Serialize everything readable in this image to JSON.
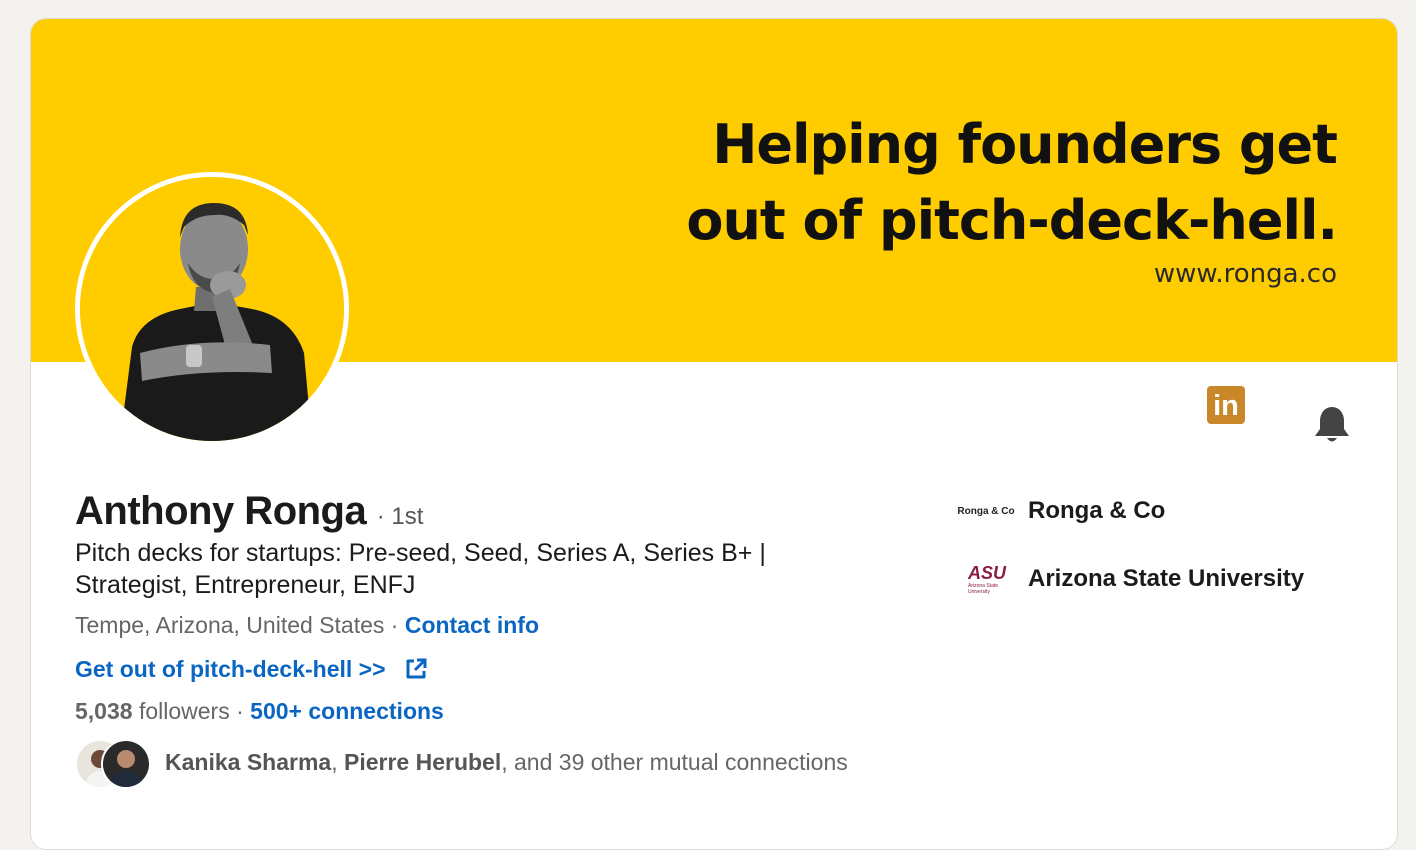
{
  "banner": {
    "headline_line1": "Helping founders get",
    "headline_line2": "out of pitch-deck-hell.",
    "url": "www.ronga.co",
    "color": "#ffcc00"
  },
  "header_actions": {
    "linkedin_badge": "in",
    "bell_icon": "bell-icon"
  },
  "profile": {
    "name": "Anthony Ronga",
    "degree": "· 1st",
    "headline": "Pitch decks for startups: Pre-seed, Seed, Series A, Series B+ | Strategist, Entrepreneur, ENFJ",
    "location": "Tempe, Arizona, United States",
    "location_separator": " · ",
    "contact_info": "Contact info",
    "website_label": "Get out of pitch-deck-hell >>",
    "followers_count": "5,038",
    "followers_label": " followers",
    "connections_separator": "  · ",
    "connections": "500+ connections",
    "mutual": {
      "person1": "Kanika Sharma",
      "separator": ", ",
      "person2": "Pierre Herubel",
      "rest": ", and 39 other mutual connections"
    }
  },
  "experience": [
    {
      "logo_text": "Ronga & Co",
      "name": "Ronga & Co"
    },
    {
      "logo_text": "ASU",
      "logo_sub": "Arizona State University",
      "name": "Arizona State University"
    }
  ],
  "colors": {
    "link": "#0a66c2",
    "li_badge": "#c9872a",
    "asu_maroon": "#8c1d40"
  }
}
